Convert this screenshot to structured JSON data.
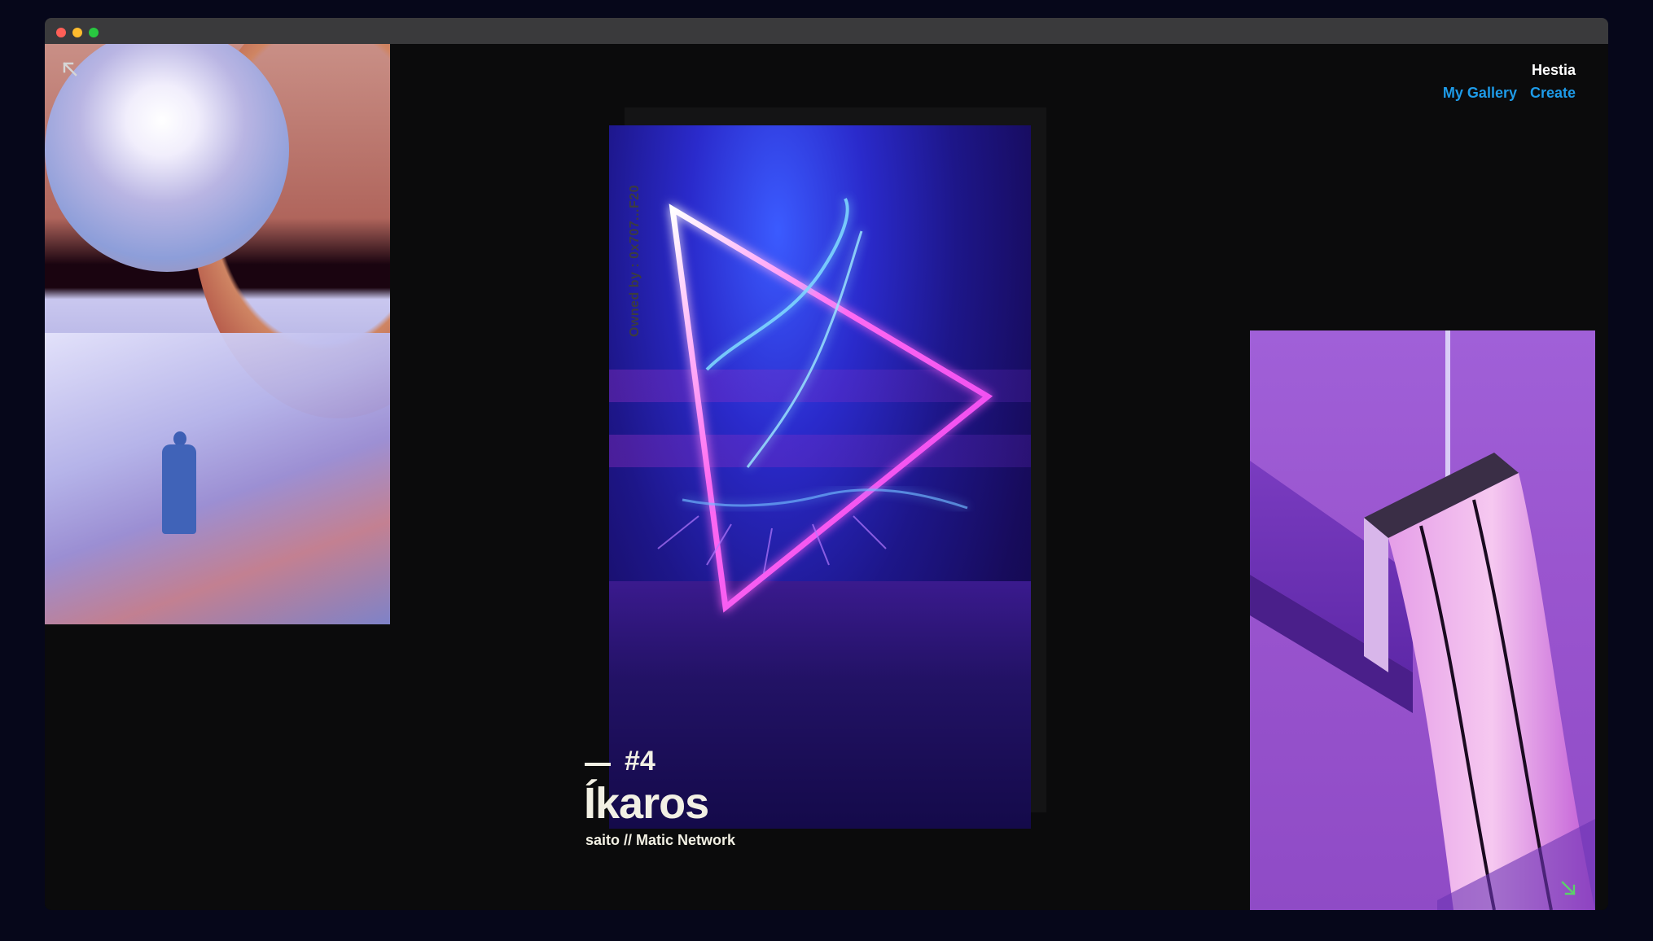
{
  "app": {
    "brand": "Hestia",
    "nav": [
      {
        "label": "My Gallery"
      },
      {
        "label": "Create"
      }
    ]
  },
  "artwork": {
    "number": "#4",
    "title": "Íkaros",
    "subtitle": "saito // Matic Network",
    "owner": "Owned by : 0x707...F20"
  },
  "icons": {
    "top_left": "arrow-up-left-icon",
    "bottom_right": "arrow-down-right-icon"
  },
  "colors": {
    "background": "#0b0b0c",
    "text": "#f2f0e4",
    "link": "#1e9be8",
    "accent_arrow": "#5ccf6b"
  }
}
